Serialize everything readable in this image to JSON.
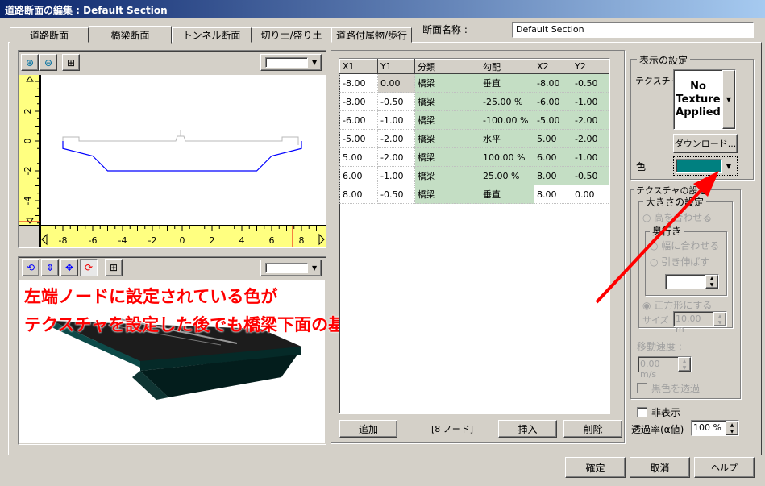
{
  "window": {
    "title": "道路断面の編集 : Default Section"
  },
  "tabs": [
    {
      "label": "道路断面"
    },
    {
      "label": "橋梁断面",
      "active": true
    },
    {
      "label": "トンネル断面"
    },
    {
      "label": "切り土/盛り土"
    },
    {
      "label": "道路付属物/歩行"
    }
  ],
  "section_name": {
    "label": "断面名称 :",
    "value": "Default Section"
  },
  "view2d": {
    "tools": [
      "zoom-in-icon",
      "zoom-out-icon",
      "fit-icon"
    ],
    "x_ticks": [
      "-8",
      "-6",
      "-4",
      "-2",
      "0",
      "2",
      "4",
      "6",
      "8"
    ],
    "y_ticks": [
      "2",
      "0",
      "-2",
      "-4"
    ],
    "outline_color": "#0000ff",
    "deck_color": "#b0b0b0",
    "bridge_nodes": [
      [
        -8,
        0
      ],
      [
        -8,
        -0.5
      ],
      [
        -6,
        -1
      ],
      [
        -5,
        -2
      ],
      [
        5,
        -2
      ],
      [
        6,
        -1
      ],
      [
        8,
        -0.5
      ],
      [
        8,
        0
      ]
    ]
  },
  "view3d": {
    "tools": [
      "rotate-icon",
      "pan-vertical-icon",
      "move-icon",
      "orbit-icon",
      "fit-icon"
    ]
  },
  "annotation": {
    "line1": "左端ノードに設定されている色が",
    "line2": "テクスチャを設定した後でも橋梁下面の基本色として設定されます",
    "color": "#ff0000"
  },
  "table": {
    "headers": [
      "X1",
      "Y1",
      "分類",
      "勾配",
      "X2",
      "Y2"
    ],
    "rows": [
      [
        "-8.00",
        "0.00",
        "橋梁",
        "垂直",
        "-8.00",
        "-0.50"
      ],
      [
        "-8.00",
        "-0.50",
        "橋梁",
        "-25.00 %",
        "-6.00",
        "-1.00"
      ],
      [
        "-6.00",
        "-1.00",
        "橋梁",
        "-100.00 %",
        "-5.00",
        "-2.00"
      ],
      [
        "-5.00",
        "-2.00",
        "橋梁",
        "水平",
        "5.00",
        "-2.00"
      ],
      [
        "5.00",
        "-2.00",
        "橋梁",
        "100.00 %",
        "6.00",
        "-1.00"
      ],
      [
        "6.00",
        "-1.00",
        "橋梁",
        "25.00 %",
        "8.00",
        "-0.50"
      ],
      [
        "8.00",
        "-0.50",
        "橋梁",
        "垂直",
        "8.00",
        "0.00"
      ]
    ]
  },
  "table_buttons": {
    "add": "追加",
    "count": "[8 ノード]",
    "insert": "挿入",
    "delete": "削除"
  },
  "display": {
    "title": "表示の設定",
    "texture_label": "テクスチャ",
    "texture_value": "No Texture Applied",
    "download": "ダウンロード...",
    "color_label": "色",
    "color": "#008080"
  },
  "texture": {
    "title": "テクスチャの設定",
    "size_group": "大きさの設定",
    "fit_height": "高を合わせる",
    "depth_group": "奥行き",
    "fit_width": "幅に合わせる",
    "stretch": "引き伸ばす",
    "square": "正方形にする",
    "size_label": "サイズ",
    "size_value": "10.00 m",
    "speed_label": "移動速度 :",
    "speed_value": "0.00 m/s",
    "black_transparent": "黒色を透過"
  },
  "hidden_label": "非表示",
  "alpha": {
    "label": "透過率(α値)",
    "value": "100 %"
  },
  "footer": {
    "ok": "確定",
    "cancel": "取消",
    "help": "ヘルプ"
  }
}
